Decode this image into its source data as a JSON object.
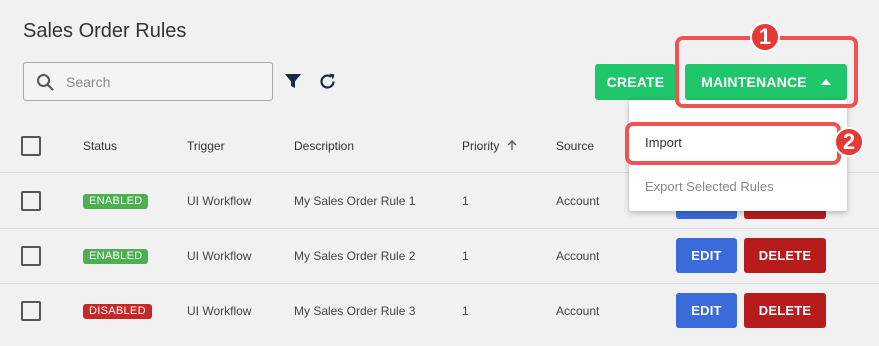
{
  "page": {
    "title": "Sales Order Rules"
  },
  "search": {
    "placeholder": "Search"
  },
  "toolbar": {
    "create_label": "CREATE",
    "maintenance_label": "MAINTENANCE"
  },
  "table": {
    "columns": [
      "Status",
      "Trigger",
      "Description",
      "Priority",
      "Source"
    ],
    "rows": [
      {
        "status": "ENABLED",
        "trigger": "UI Workflow",
        "description": "My Sales Order Rule 1",
        "priority": "1",
        "source": "Account"
      },
      {
        "status": "ENABLED",
        "trigger": "UI Workflow",
        "description": "My Sales Order Rule 2",
        "priority": "1",
        "source": "Account",
        "edit": "EDIT",
        "delete": "DELETE"
      },
      {
        "status": "DISABLED",
        "trigger": "UI Workflow",
        "description": "My Sales Order Rule 3",
        "priority": "1",
        "source": "Account",
        "edit": "EDIT",
        "delete": "DELETE"
      }
    ]
  },
  "dropdown": {
    "items": [
      "Import",
      "Export Selected Rules"
    ]
  },
  "annotations": {
    "callout_1": "1",
    "callout_2": "2"
  },
  "colors": {
    "green": "#1fc66a",
    "blue": "#3b6bd9",
    "red": "#b71c1c",
    "enabled": "#4caf50",
    "disabled": "#c62828",
    "annotation": "#e53935"
  }
}
